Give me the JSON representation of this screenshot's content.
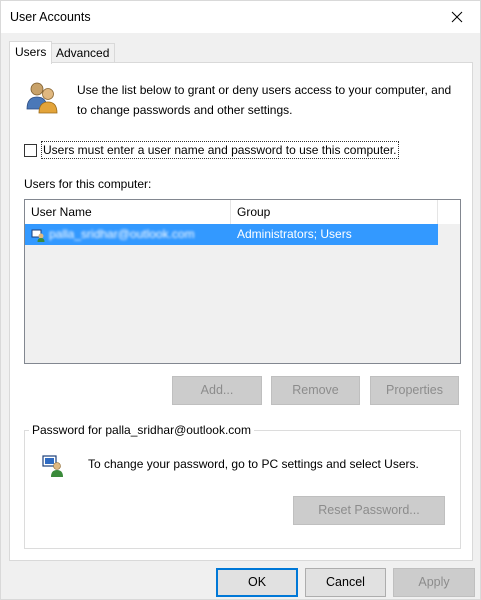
{
  "window": {
    "title": "User Accounts"
  },
  "tabs": [
    {
      "label": "Users",
      "active": true
    },
    {
      "label": "Advanced",
      "active": false
    }
  ],
  "intro": {
    "text": "Use the list below to grant or deny users access to your computer, and to change passwords and other settings.",
    "icon": "users-icon"
  },
  "require_login": {
    "label": "Users must enter a user name and password to use this computer.",
    "checked": false
  },
  "users_list": {
    "label": "Users for this computer:",
    "columns": [
      "User Name",
      "Group"
    ],
    "rows": [
      {
        "name": "palla_sridhar@outlook.com",
        "group": "Administrators; Users",
        "selected": true
      }
    ]
  },
  "list_buttons": {
    "add": "Add...",
    "remove": "Remove",
    "properties": "Properties"
  },
  "password_group": {
    "title": "Password for palla_sridhar@outlook.com",
    "text": "To change your password, go to PC settings and select Users.",
    "reset_button": "Reset Password..."
  },
  "dialog_buttons": {
    "ok": "OK",
    "cancel": "Cancel",
    "apply": "Apply"
  },
  "colors": {
    "selection": "#3399ff",
    "accent": "#0078d7"
  }
}
